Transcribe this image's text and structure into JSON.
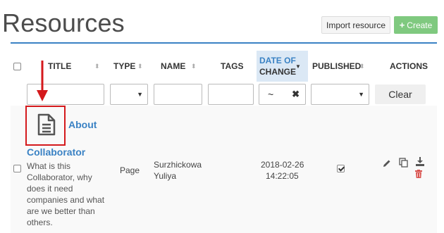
{
  "page": {
    "title": "Resources"
  },
  "toolbar": {
    "import_label": "Import resource",
    "create_label": "Create"
  },
  "table": {
    "columns": {
      "title": "TITLE",
      "type": "TYPE",
      "name": "NAME",
      "tags": "TAGS",
      "date_line1": "DATE OF",
      "date_line2": "CHANGE",
      "published": "PUBLISHED",
      "actions": "ACTIONS"
    },
    "filters": {
      "date_tilde": "~",
      "clear_label": "Clear"
    },
    "rows": [
      {
        "title_line1": "About",
        "title_line2": "Collaborator",
        "description": "What is this Collaborator, why does it need companies and what are we better than others.",
        "type": "Page",
        "name_line1": "Surzhickowa",
        "name_line2": "Yuliya",
        "date_line1": "2018-02-26",
        "date_line2": "14:22:05",
        "published": true
      }
    ]
  },
  "colors": {
    "accent": "#3a82c4",
    "create_green": "#7fc97f",
    "highlight_red": "#d4191c",
    "delete_red": "#d9534f"
  },
  "icons": [
    "document-icon",
    "pencil-icon",
    "copy-icon",
    "download-icon",
    "trash-icon",
    "sort-icon",
    "annotation-arrow"
  ]
}
